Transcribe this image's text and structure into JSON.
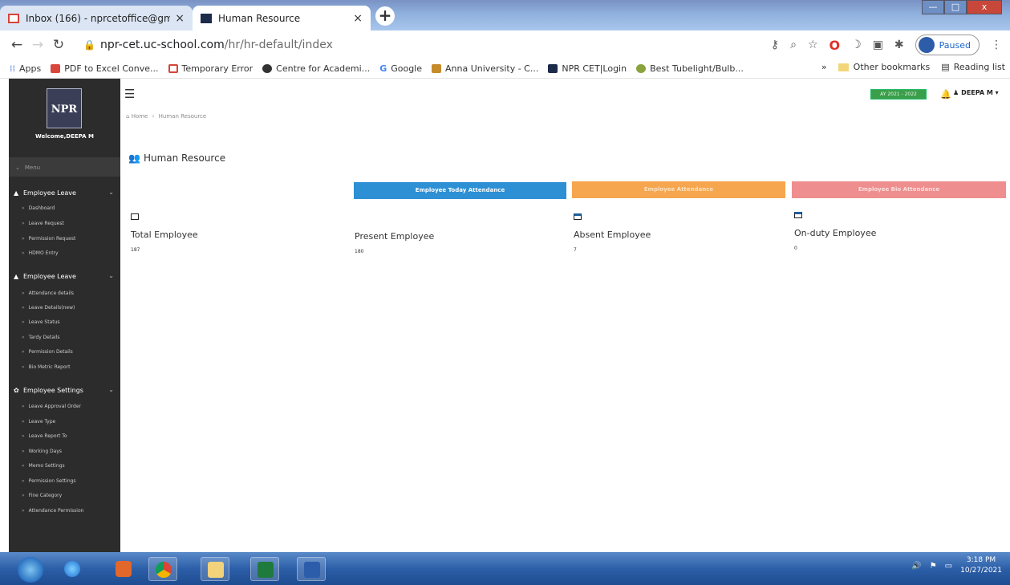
{
  "browser": {
    "tabs": [
      {
        "title": "Inbox (166) - nprcetoffice@gma",
        "icon": "gmail-icon"
      },
      {
        "title": "Human Resource",
        "icon": "npr-favicon-icon"
      }
    ],
    "new_tab_label": "+",
    "window_controls": {
      "minimize": "—",
      "maximize": "□",
      "close": "x"
    },
    "url_host": "npr-cet.uc-school.com",
    "url_path": "/hr/hr-default/index",
    "profile_status": "Paused"
  },
  "bookmarks": [
    {
      "label": "Apps",
      "color": "#4a7fd6"
    },
    {
      "label": "PDF to Excel Conve...",
      "color": "#d9473c"
    },
    {
      "label": "Temporary Error",
      "color": "#d44638"
    },
    {
      "label": "Centre for Academi...",
      "color": "#333333"
    },
    {
      "label": "Google",
      "color": "#4285f4"
    },
    {
      "label": "Anna University - C...",
      "color": "#c58a2a"
    },
    {
      "label": "NPR CET|Login",
      "color": "#1c2b4a"
    },
    {
      "label": "Best Tubelight/Bulb...",
      "color": "#8aa33c"
    }
  ],
  "bookmarks_right": {
    "overflow": "»",
    "other": "Other bookmarks",
    "reading": "Reading list"
  },
  "sidebar": {
    "logo_text": "NPR",
    "welcome": "Welcome,DEEPA M",
    "menu_header": "Menu",
    "groups": [
      {
        "label": "Employee Leave",
        "icon": "user-icon",
        "items": [
          "Dashboard",
          "Leave Request",
          "Permission Request",
          "HDMO Entry"
        ]
      },
      {
        "label": "Employee Leave",
        "icon": "user-icon",
        "items": [
          "Attendance details",
          "Leave Details(new)",
          "Leave Status",
          "Tardy Details",
          "Permission Details",
          "Bio Metric Report"
        ]
      },
      {
        "label": "Employee Settings",
        "icon": "gear-icon",
        "items": [
          "Leave Approval Order",
          "Leave Type",
          "Leave Report To",
          "Working Days",
          "Memo Settings",
          "Permission Settings",
          "Fine Category",
          "Attendance Permission"
        ]
      }
    ]
  },
  "header": {
    "academic_year": "AY 2021 - 2022",
    "user": "DEEPA M"
  },
  "breadcrumb": {
    "home": "Home",
    "current": "Human Resource"
  },
  "page_title": "Human Resource",
  "actions": [
    {
      "label": "Employee Today Attendance",
      "color": "#2d8fd4"
    },
    {
      "label": "Employee Attendance",
      "color": "#f5a64e"
    },
    {
      "label": "Employee Bio Attendance",
      "color": "#ee8e8e"
    }
  ],
  "stats": [
    {
      "label": "Total Employee",
      "value": "187"
    },
    {
      "label": "Present Employee",
      "value": "180"
    },
    {
      "label": "Absent Employee",
      "value": "7"
    },
    {
      "label": "On-duty Employee",
      "value": "0"
    }
  ],
  "taskbar": {
    "time": "3:18 PM",
    "date": "10/27/2021"
  }
}
